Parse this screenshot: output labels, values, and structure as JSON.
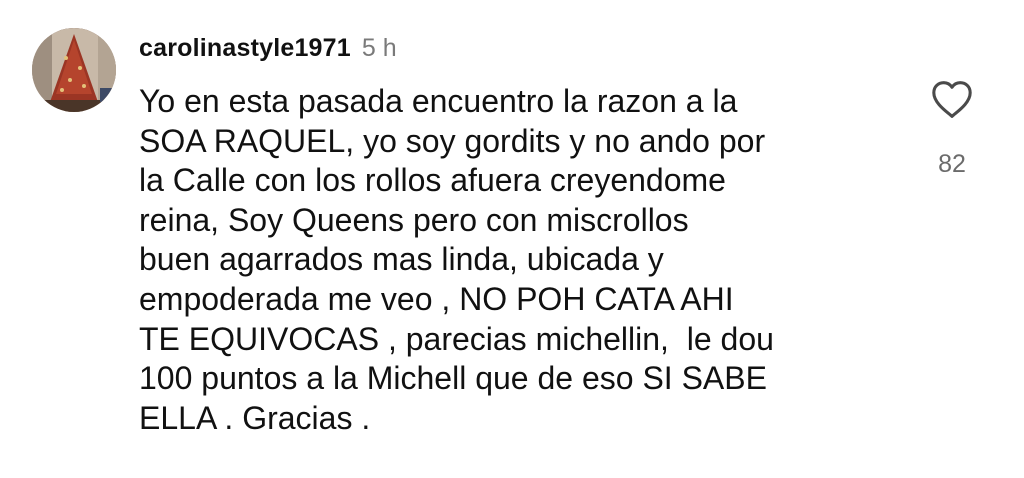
{
  "comment": {
    "username": "carolinastyle1971",
    "timestamp": "5 h",
    "text_lines": [
      "Yo en esta pasada encuentro la razon a la",
      "SOA RAQUEL, yo soy gordits y no ando por",
      "la Calle con los rollos afuera creyendome",
      "reina, Soy Queens pero con miscrollos",
      "buen agarrados mas linda, ubicada y",
      "empoderada me veo , NO POH CATA AHI",
      "TE EQUIVOCAS , parecias michellin,  le dou",
      "100 puntos a la Michell que de eso SI SABE",
      "ELLA . Gracias ."
    ],
    "like_icon": "heart-outline-icon",
    "like_count": "82"
  },
  "colors": {
    "text": "#111111",
    "muted": "#7a7a7a",
    "background": "#ffffff"
  }
}
